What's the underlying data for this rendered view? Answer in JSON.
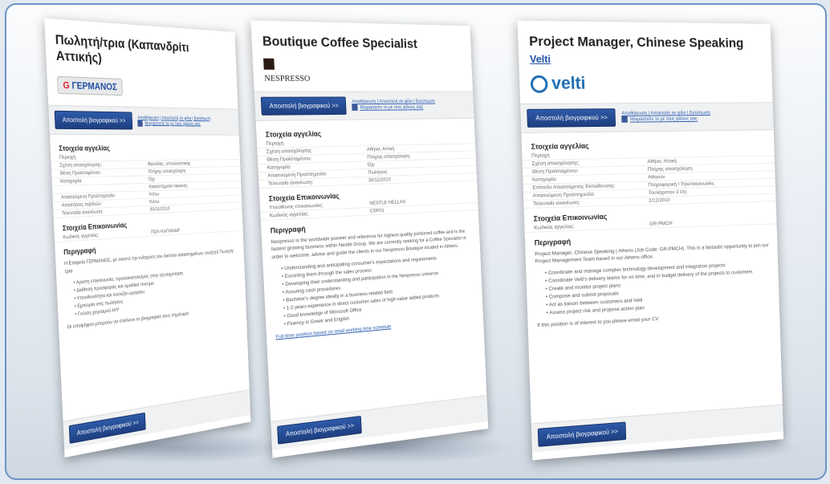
{
  "submit_label": "Αποστολή βιογραφικού >>",
  "share_link": "Αποθήκευση | Αποστολή σε φίλο | Εκτύπωση",
  "share_fb": "Μοιραστείτε το με τους φίλους σας",
  "pages": [
    {
      "title": "Πωλητή/τρια (Καπανδρίτι Αττικής)",
      "company_link": "",
      "logo_text": "ΓΕΡΜΑΝΟΣ",
      "section1": "Στοιχεία αγγελίας",
      "region": "Περιοχή",
      "rows": [
        [
          "Σχέση απασχόλησης:",
          "Βασιλίας, αποκλειστικής"
        ],
        [
          "Θέση Προϊσταμένου:",
          "Πλήρης απασχόληση"
        ],
        [
          "Κατηγορία:",
          "Όχι"
        ],
        [
          "",
          "Καταστήματα λιανικής"
        ],
        [
          "Απαιτούμενη Προϋπηρεσία:",
          "Κάτω"
        ],
        [
          "Απαιτήσεις ταξιδιών:",
          "Κάτω"
        ],
        [
          "Τελευταία ανανέωση:",
          "30/11/2010"
        ]
      ],
      "section2": "Στοιχεία Επικοινωνίας",
      "contact_rows": [
        [
          "Κωδικός αγγελίας:",
          "ΠΩΛ-ΚΑΠΑΝΔΡ"
        ]
      ],
      "section3": "Περιγραφή",
      "desc": "Η Εταιρεία ΓΕΡΜΑΝΟΣ, με σκοπό την ενίσχυση του δικτύου καταστημάτων, αναζητά Πωλητή/τρια",
      "bullets": [
        "Αριστη επικοινωνία, προσανατολισμός στην εξυπηρέτηση",
        "Διάθεση προσφοράς και ομαδικό πνεύμα",
        "Υπευθυνότητα και ευελιξία ωραρίου",
        "Εμπειρία στις πωλήσεις",
        "Γνώση χειρισμού Η/Υ"
      ],
      "footer_note": "Οι υποψήφιοι μπορούν να στείλουν το βιογραφικό τους σημείωμα"
    },
    {
      "title": "Boutique Coffee Specialist",
      "company_link": "",
      "logo_text": "NESPRESSO",
      "section1": "Στοιχεία αγγελίας",
      "region": "Περιοχή",
      "rows": [
        [
          "Σχέση απασχόλησης:",
          "Αθήνα, Αττική"
        ],
        [
          "Θέση Προϊσταμένου:",
          "Πλήρης απασχόληση"
        ],
        [
          "Κατηγορία:",
          "Όχι"
        ],
        [
          "Απαιτούμενη Προϋπηρεσία:",
          "Πωλήσεις"
        ],
        [
          "Τελευταία ανανέωση:",
          "30/11/2010"
        ]
      ],
      "section2": "Στοιχεία Επικοινωνίας",
      "contact_rows": [
        [
          "Υπεύθυνος επικοινωνίας:",
          "NESTLE HELLAS"
        ],
        [
          "Κωδικός αγγελίας:",
          "CSP01"
        ]
      ],
      "section3": "Περιγραφή",
      "desc": "Nespresso is the worldwide pioneer and reference for highest quality portioned coffee and is the fastest growing business within Nestlé Group. We are currently seeking for a Coffee Specialist in order to welcome, advise and guide the clients in our Nespresso Boutique located in Athens.",
      "bullets": [
        "Understanding and anticipating consumer's expectations and requirements",
        "Escorting them through the sales process",
        "Developing their understanding and participation in the Nespresso universe",
        "Assuring cash procedures",
        "Bachelor's degree ideally in a business-related field",
        "1-2 years experience in direct customer sales of high-value added products",
        "Good knowledge of Microsoft Office",
        "Fluency in Greek and English"
      ],
      "footer_note": "Full-time position based on retail working time schedule"
    },
    {
      "title": "Project Manager, Chinese Speaking",
      "company_link": "Velti",
      "logo_text": "velti",
      "section1": "Στοιχεία αγγελίας",
      "region": "Περιοχή",
      "rows": [
        [
          "Σχέση απασχόλησης:",
          "Αθήνα, Αττική"
        ],
        [
          "Θέση Προϊσταμένου:",
          "Πλήρης απασχόληση"
        ],
        [
          "Κατηγορία:",
          "Αθηνών"
        ],
        [
          "Επίπεδο Απαιτούμενης Εκπαίδευσης:",
          "Πληροφορική / Τηλεπικοινωνίες"
        ],
        [
          "Απαιτούμενη Προϋπηρεσία:",
          "Τουλάχιστον 3 έτη"
        ],
        [
          "Τελευταία ανανέωση:",
          "2/12/2010"
        ]
      ],
      "section2": "Στοιχεία Επικοινωνίας",
      "contact_rows": [
        [
          "Κωδικός αγγελίας:",
          "GR-PMCH"
        ]
      ],
      "section3": "Περιγραφή",
      "desc": "Project Manager, Chinese Speaking | Athens (Job Code: GR-PMCH). This is a fantastic opportunity to join our Project Management Team based in our Athens office.",
      "bullets": [
        "Coordinate and manage complex technology development and integration projects",
        "Coordinate Velti's delivery teams for on time, and in budget delivery of the projects to customers",
        "Create and monitor project plans",
        "Compose and submit proposals",
        "Act as liaison between customers and Velti",
        "Assess project risk and propose action plan"
      ],
      "footer_note": "If this position is of interest to you please email your CV"
    }
  ]
}
